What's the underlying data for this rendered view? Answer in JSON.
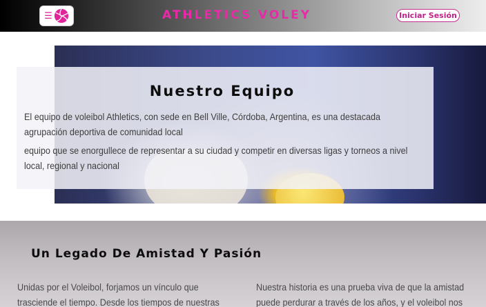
{
  "header": {
    "brand": "ATHLETICS VOLEY",
    "menu_icon": "hamburger-icon",
    "logo_icon": "volleyball-icon",
    "login_label": "Iniciar Sesión"
  },
  "hero": {
    "title": "Nuestro Equipo",
    "paragraph_1": "El equipo de voleibol Athletics, con sede en Bell Ville, Córdoba, Argentina, es una destacada agrupación deportiva de comunidad local",
    "paragraph_2": "equipo que se enorgullece de representar a su ciudad y competir en diversas ligas y torneos a nivel local, regional y nacional"
  },
  "legacy": {
    "title": "Un Legado De Amistad Y Pasión",
    "left_text": "Unidas por el Voleibol, forjamos un vínculo que trasciende el tiempo. Desde los tiempos de nuestras",
    "right_text": "Nuestra historia es una prueba viva de que la amistad puede perdurar a través de los años, y el voleibol nos"
  },
  "colors": {
    "accent": "#e82aa8",
    "header_dark": "#000000",
    "header_light": "#ededed"
  }
}
